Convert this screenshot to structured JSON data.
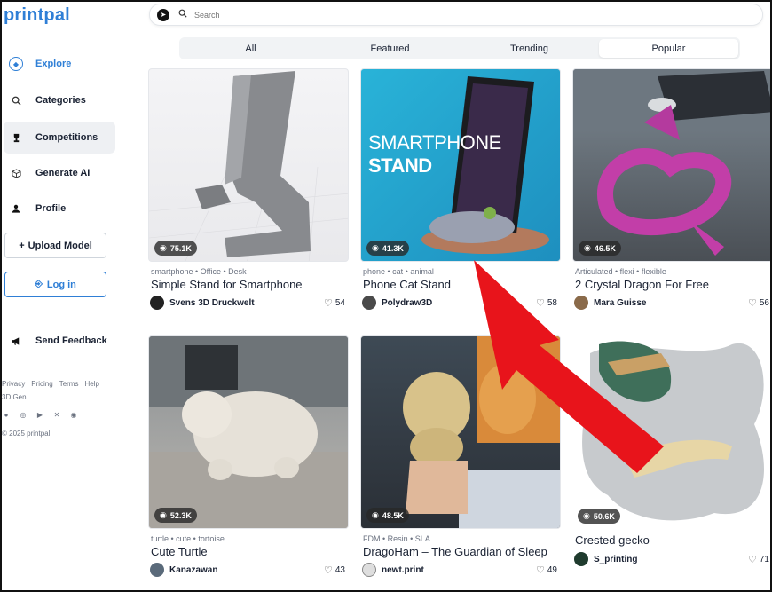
{
  "brand": {
    "logo": "printpal"
  },
  "sidebar": {
    "items": [
      {
        "label": "Explore",
        "icon": "compass-icon"
      },
      {
        "label": "Categories",
        "icon": "search-icon"
      },
      {
        "label": "Competitions",
        "icon": "trophy-icon"
      },
      {
        "label": "Generate AI",
        "icon": "cube-icon"
      },
      {
        "label": "Profile",
        "icon": "user-icon"
      }
    ],
    "upload_label": "Upload Model",
    "login_label": "Log in",
    "feedback_label": "Send Feedback",
    "footer_links": [
      "Privacy",
      "Pricing",
      "Terms",
      "Help",
      "3D Gen"
    ],
    "copyright": "© 2025 printpal"
  },
  "search": {
    "placeholder": "Search"
  },
  "tabs": [
    {
      "label": "All"
    },
    {
      "label": "Featured"
    },
    {
      "label": "Trending"
    },
    {
      "label": "Popular",
      "selected": true
    }
  ],
  "cards": [
    {
      "views": "75.1K",
      "tags": "smartphone • Office • Desk",
      "title": "Simple Stand for Smartphone",
      "author": "Svens 3D Druckwelt",
      "likes": "54"
    },
    {
      "views": "41.3K",
      "tags": "phone • cat • animal",
      "title": "Phone Cat Stand",
      "author": "Polydraw3D",
      "likes": "58",
      "image_text": [
        "SMARTPHONE",
        "STAND"
      ]
    },
    {
      "views": "46.5K",
      "tags": "Articulated • flexi • flexible",
      "title": "2 Crystal Dragon For Free",
      "author": "Mara Guisse",
      "likes": "56"
    },
    {
      "views": "52.3K",
      "tags": "turtle • cute • tortoise",
      "title": "Cute Turtle",
      "author": "Kanazawan",
      "likes": "43"
    },
    {
      "views": "48.5K",
      "tags": "FDM • Resin • SLA",
      "title": "DragoHam – The Guardian of Sleep",
      "author": "newt.print",
      "likes": "49"
    },
    {
      "views": "50.6K",
      "tags": "",
      "title": "Crested gecko",
      "author": "S_printing",
      "likes": "71"
    }
  ],
  "colors": {
    "accent": "#2f7fd6",
    "arrow": "#e8141b"
  }
}
